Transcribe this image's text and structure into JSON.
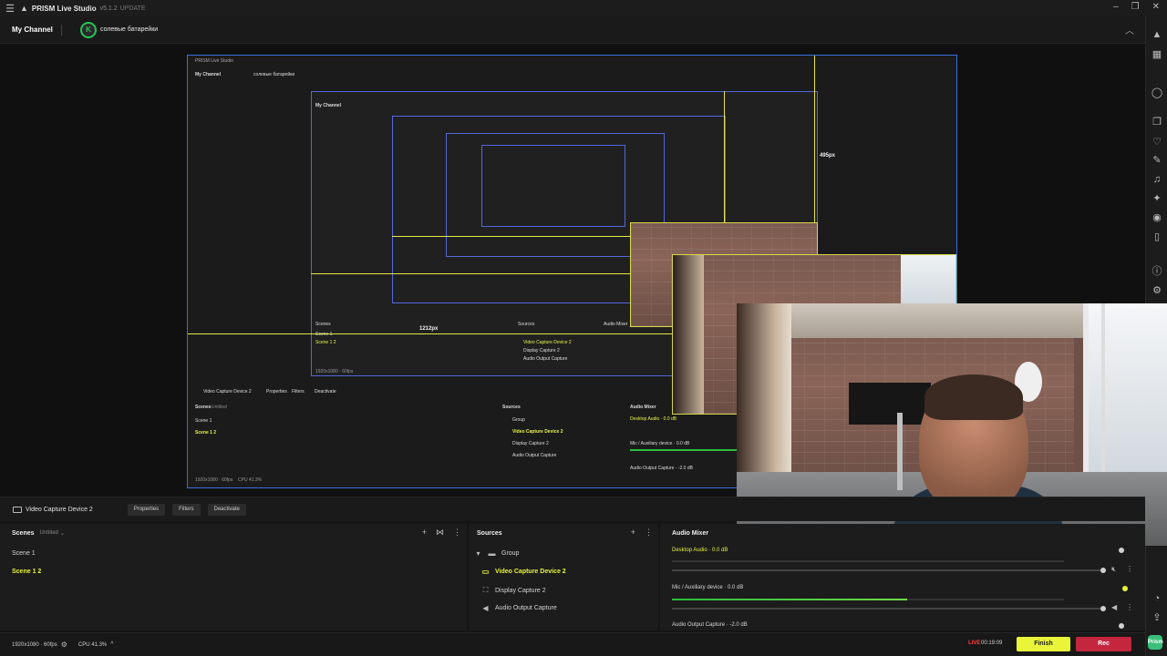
{
  "titlebar": {
    "app_name": "PRISM Live Studio",
    "version": "v5.1.2",
    "update_label": "UPDATE",
    "icons": [
      "menu-icon",
      "prism-logo-icon",
      "minimize-icon",
      "maximize-icon",
      "close-icon"
    ]
  },
  "channel": {
    "title": "My Channel",
    "account_name": "солевые батарейки",
    "avatar_letter": "K"
  },
  "preview": {
    "width_label": "1212px",
    "height_label": "495px"
  },
  "source_toolbar": {
    "selected_source": "Video Capture Device 2",
    "properties_label": "Properties",
    "filters_label": "Filters",
    "deactivate_label": "Deactivate"
  },
  "scenes": {
    "title": "Scenes",
    "collection": "Untitled",
    "items": [
      {
        "label": "Scene 1",
        "active": false
      },
      {
        "label": "Scene 1 2",
        "active": true
      }
    ]
  },
  "sources": {
    "title": "Sources",
    "items": [
      {
        "label": "Group",
        "icon": "folder-icon",
        "active": false
      },
      {
        "label": "Video Capture Device 2",
        "icon": "camera-icon",
        "active": true
      },
      {
        "label": "Display Capture 2",
        "icon": "display-capture-icon",
        "active": false
      },
      {
        "label": "Audio Output Capture",
        "icon": "speaker-icon",
        "active": false
      }
    ]
  },
  "mixer": {
    "title": "Audio Mixer",
    "channels": [
      {
        "name": "Desktop Audio",
        "db": "0.0 dB",
        "level": 0.0
      },
      {
        "name": "Mic / Auxiliary device",
        "db": "0.0 dB",
        "level": 0.6
      },
      {
        "name": "Audio Output Capture",
        "db": "-2.0 dB",
        "level": 0.0
      }
    ]
  },
  "status": {
    "resolution": "1920x1080 · 60fps",
    "cpu": "CPU 41.3%",
    "live_label": "LIVE",
    "live_time": "00:19:09",
    "finish_label": "Finish",
    "rec_label": "Rec",
    "chat_label": "Prism"
  },
  "nested_preview": {
    "scene_1": "Scene 1",
    "scene_2": "Scene 1 2",
    "video_capture": "Video Capture Device 2",
    "display_capture": "Display Capture 2",
    "audio_output": "Audio Output Capture",
    "group": "Group",
    "desktop_audio": "Desktop Audio · 0.0 dB",
    "mic_aux": "Mic / Auxiliary device · 0.0 dB",
    "audio_output_db": "Audio Output Capture · -2.0 dB",
    "scenes": "Scenes",
    "sources": "Sources",
    "audio_mixer": "Audio Mixer",
    "untitled": "Untitled",
    "properties": "Properties",
    "filters": "Filters",
    "deactivate": "Deactivate",
    "channel": "My Channel",
    "status": "1920x1080 · 60fps",
    "cpu": "CPU 41.3%"
  },
  "colors": {
    "accent_yellow": "#e6f33c",
    "rec_red": "#c3263d",
    "selection_blue": "#3c6fe0",
    "meter_green": "#2bbd3b"
  }
}
